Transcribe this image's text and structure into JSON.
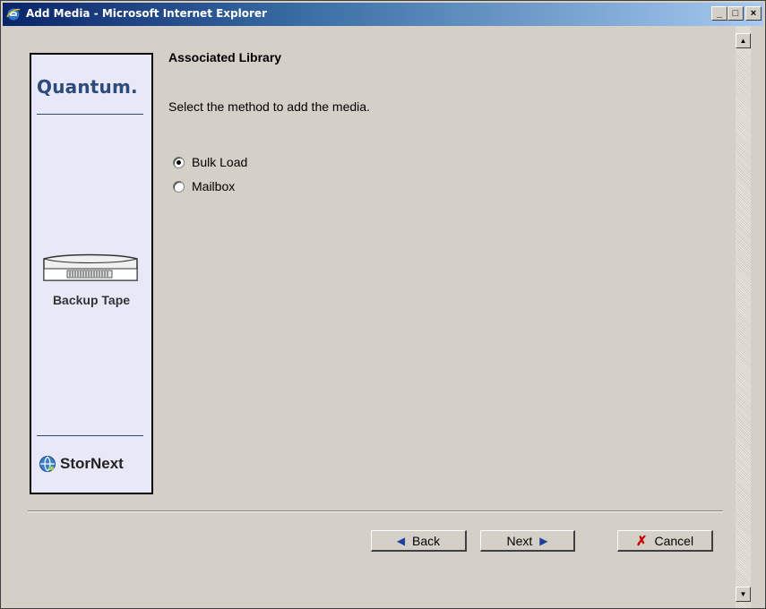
{
  "window": {
    "title": "Add Media - Microsoft Internet Explorer",
    "minimize_label": "_",
    "maximize_label": "□",
    "close_label": "×"
  },
  "sidebar": {
    "brand": "Quantum.",
    "section_label": "Backup Tape",
    "footer_brand": "StorNext"
  },
  "main": {
    "heading": "Associated Library",
    "instruction": "Select the method to add the media.",
    "options": [
      {
        "label": "Bulk Load",
        "selected": true
      },
      {
        "label": "Mailbox",
        "selected": false
      }
    ]
  },
  "footer": {
    "back_label": "Back",
    "next_label": "Next",
    "cancel_label": "Cancel"
  },
  "colors": {
    "dialog_bg": "#d4d0c8",
    "sidebar_bg": "#e8e8f8",
    "brand_blue": "#2c4a7a",
    "arrow_blue": "#1f3f9f",
    "cancel_red": "#cc0000"
  }
}
